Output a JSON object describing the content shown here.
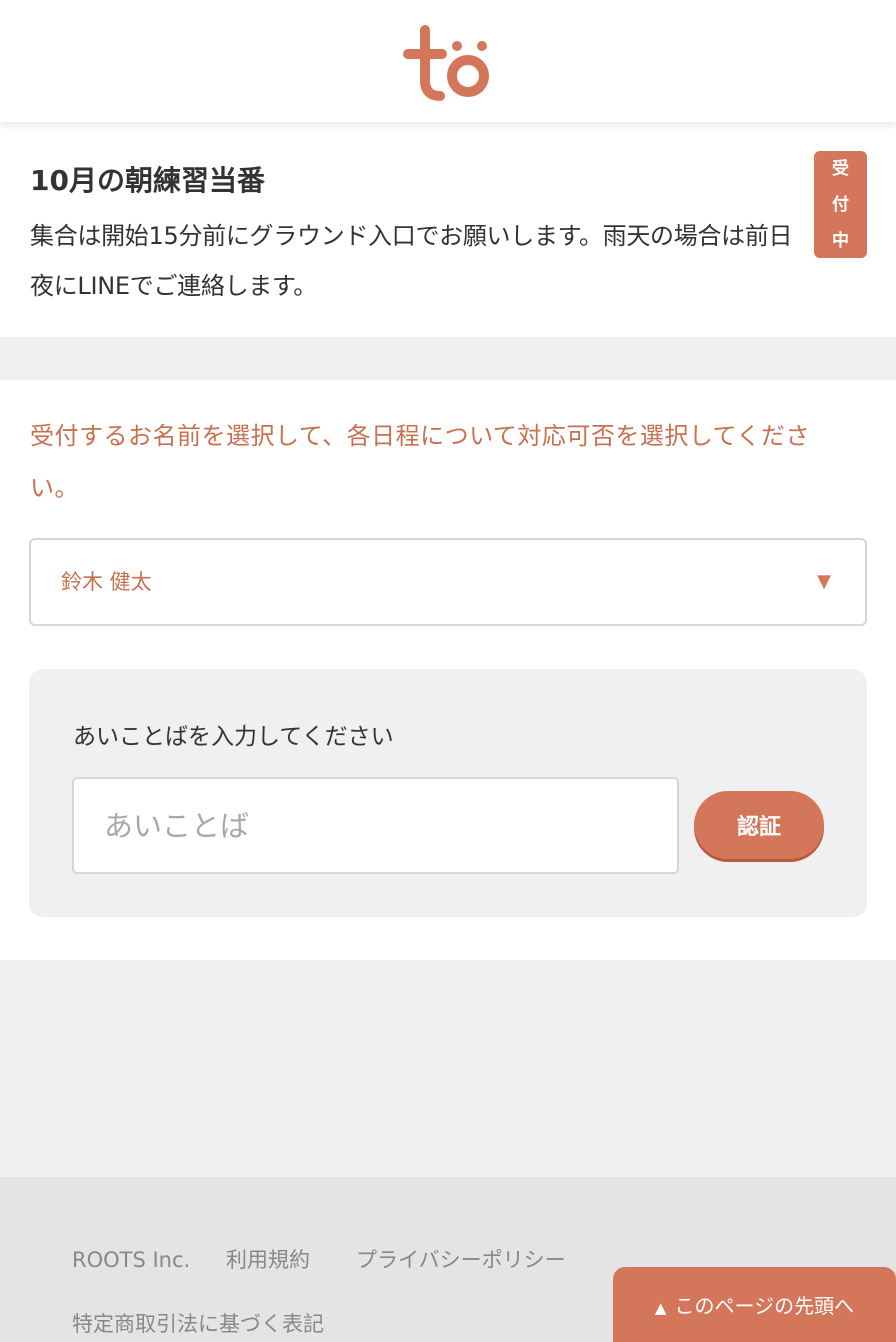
{
  "brand": {
    "accent_color": "#d4765a",
    "text_accent_color": "#c9714f"
  },
  "header": {
    "logo_icon": "to-logo-icon"
  },
  "event": {
    "title": "10月の朝練習当番",
    "description": "集合は開始15分前にグラウンド入口でお願いします。雨天の場合は前日夜にLINEでご連絡します。",
    "status_badge": [
      "受",
      "付",
      "中"
    ]
  },
  "form": {
    "instruction": "受付するお名前を選択して、各日程について対応可否を選択してください。",
    "name_select": {
      "selected": "鈴木 健太",
      "arrow_icon": "triangle-down-icon"
    },
    "auth": {
      "label": "あいことばを入力してください",
      "input_value": "",
      "input_placeholder": "あいことば",
      "button_label": "認証"
    }
  },
  "footer": {
    "links": [
      "ROOTS Inc.",
      "利用規約",
      "プライバシーポリシー",
      "特定商取引法に基づく表記"
    ]
  },
  "back_to_top": {
    "label": "このページの先頭へ",
    "icon": "triangle-up-icon"
  }
}
